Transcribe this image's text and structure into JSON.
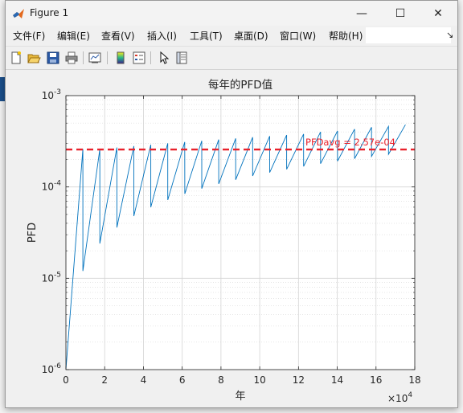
{
  "window": {
    "title": "Figure 1",
    "controls": {
      "minimize": "—",
      "maximize": "☐",
      "close": "✕"
    }
  },
  "menu": {
    "items": [
      "文件(F)",
      "编辑(E)",
      "查看(V)",
      "插入(I)",
      "工具(T)",
      "桌面(D)",
      "窗口(W)",
      "帮助(H)"
    ],
    "overflow": "↘"
  },
  "toolbar": {
    "tools": [
      "new-figure-icon",
      "open-file-icon",
      "save-icon",
      "print-icon",
      "link-plot-icon",
      "colorbar-icon",
      "legend-icon",
      "pointer-icon",
      "property-inspector-icon"
    ]
  },
  "chart_data": {
    "type": "line",
    "title": "每年的PFD值",
    "xlabel": "年",
    "ylabel": "PFD",
    "x_exponent": "×10^4",
    "xlim": [
      0,
      180000
    ],
    "ylim": [
      1e-06,
      0.001
    ],
    "yscale": "log",
    "grid": true,
    "xticks": [
      0,
      2,
      4,
      6,
      8,
      10,
      12,
      14,
      16,
      18
    ],
    "yticks": [
      "10^-6",
      "10^-5",
      "10^-4",
      "10^-3"
    ],
    "series": [
      {
        "color": "#0072bd",
        "x": [
          0,
          8760,
          8761,
          17520,
          17521,
          26280,
          26281,
          35040,
          35041,
          43800,
          43801,
          52560,
          52561,
          61320,
          61321,
          70080,
          70081,
          78840,
          78841,
          87600,
          87601,
          96360,
          96361,
          105120,
          105121,
          113880,
          113881,
          122640,
          122641,
          131400,
          131401,
          140160,
          140161,
          148920,
          148921,
          157680,
          157681,
          166440,
          166441,
          175200
        ],
        "y": [
          1e-06,
          0.00026,
          1.2e-05,
          0.00026,
          2.4e-05,
          0.00027,
          3.6e-05,
          0.00028,
          4.8e-05,
          0.00029,
          6e-05,
          0.0003,
          7.2e-05,
          0.00031,
          8.4e-05,
          0.00032,
          9.6e-05,
          0.00033,
          0.000108,
          0.00034,
          0.00012,
          0.00035,
          0.000132,
          0.00036,
          0.000144,
          0.00037,
          0.000156,
          0.00038,
          0.000168,
          0.0004,
          0.00018,
          0.00041,
          0.000192,
          0.00043,
          0.000204,
          0.00045,
          0.000216,
          0.00046,
          0.000228,
          0.00048
        ]
      }
    ],
    "reference_line": {
      "y": 0.000257,
      "color": "#e8222c",
      "style": "dashed"
    },
    "annotation": {
      "text": "PFDavg = 2.57e-04",
      "color": "#e8222c"
    }
  }
}
